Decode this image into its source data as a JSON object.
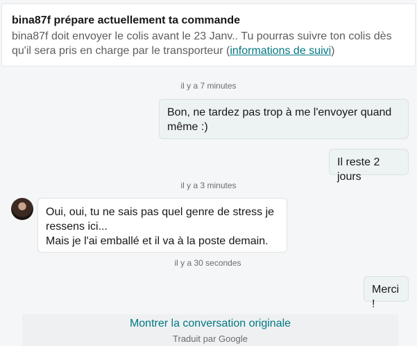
{
  "banner": {
    "title": "bina87f prépare actuellement ta commande",
    "body": "bina87f doit envoyer le colis avant le 23 Janv.. Tu pourras suivre ton colis dès qu'il sera pris en charge par le transporteur (",
    "link": "informations de suivi",
    "body_end": ")"
  },
  "messages": [
    {
      "type": "timestamp",
      "text": "il y a 7 minutes"
    },
    {
      "type": "outgoing",
      "lines": [
        "Bon, ne tardez pas trop à me l'envoyer quand",
        "même :)"
      ]
    },
    {
      "type": "outgoing",
      "lines": [
        "Il reste 2 jours"
      ]
    },
    {
      "type": "timestamp",
      "text": "il y a 3 minutes"
    },
    {
      "type": "incoming",
      "lines": [
        "Oui, oui, tu ne sais pas quel genre de stress je",
        "ressens ici...",
        "Mais je l'ai emballé et il va à la poste demain."
      ]
    },
    {
      "type": "timestamp",
      "text": "il y a 30 secondes"
    },
    {
      "type": "outgoing",
      "lines": [
        "Merci !"
      ]
    }
  ],
  "translation": {
    "show_original": "Montrer la conversation originale",
    "note": "Traduit par Google"
  },
  "colors": {
    "link": "#007782",
    "outgoing_bubble": "#edf2f2",
    "incoming_bubble": "#ffffff"
  }
}
